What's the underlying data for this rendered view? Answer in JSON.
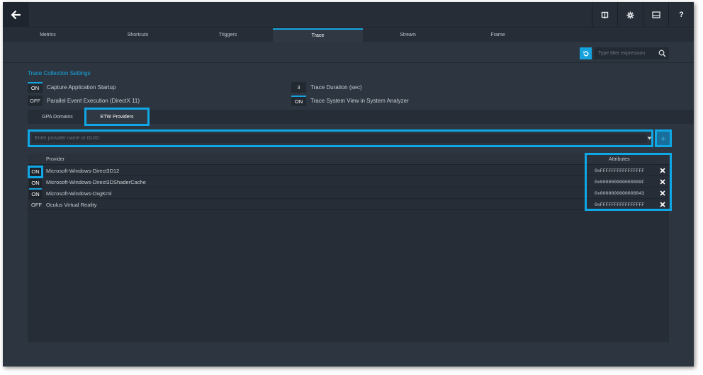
{
  "topbar": {
    "icons": [
      "back-arrow-icon",
      "book-icon",
      "gear-icon",
      "mail-icon",
      "help-icon"
    ],
    "help_label": "?"
  },
  "tabs": [
    {
      "label": "Metrics",
      "active": false
    },
    {
      "label": "Shortcuts",
      "active": false
    },
    {
      "label": "Triggers",
      "active": false
    },
    {
      "label": "Trace",
      "active": true
    },
    {
      "label": "Stream",
      "active": false
    },
    {
      "label": "Frame",
      "active": false
    }
  ],
  "filter": {
    "placeholder": "Type filter expression"
  },
  "trace_settings": {
    "title": "Trace Collection Settings",
    "capture_startup": {
      "state": "ON",
      "label": "Capture Application Startup"
    },
    "parallel_events": {
      "state": "OFF",
      "label": "Parallel Event Execution (DirectX 11)"
    },
    "trace_duration": {
      "value": "3",
      "label": "Trace Duration (sec)"
    },
    "system_view": {
      "state": "ON",
      "label": "Trace System View in System Analyzer"
    }
  },
  "subtabs": [
    {
      "label": "GPA Domains",
      "active": false
    },
    {
      "label": "ETW Providers",
      "active": true
    }
  ],
  "provider_input": {
    "placeholder": "Enter provider name or GUID",
    "add_label": "+"
  },
  "table": {
    "headers": {
      "provider": "Provider",
      "attributes": "Attributes"
    },
    "rows": [
      {
        "state": "ON",
        "provider": "Microsoft-Windows-Direct3D12",
        "attributes": "0xFFFFFFFFFFFFFFFF"
      },
      {
        "state": "ON",
        "provider": "Microsoft-Windows-Direct3DShaderCache",
        "attributes": "0x000000000000000F"
      },
      {
        "state": "ON",
        "provider": "Microsoft-Windows-DxgKrnl",
        "attributes": "0x0000000000008843"
      },
      {
        "state": "OFF",
        "provider": "Oculus Virtual Reality",
        "attributes": "0xFFFFFFFFFFFFFFFF"
      }
    ]
  },
  "colors": {
    "accent": "#16a3dd",
    "highlight": "#0fa8e6",
    "background": "#2d3540",
    "topbar": "#262d37"
  }
}
